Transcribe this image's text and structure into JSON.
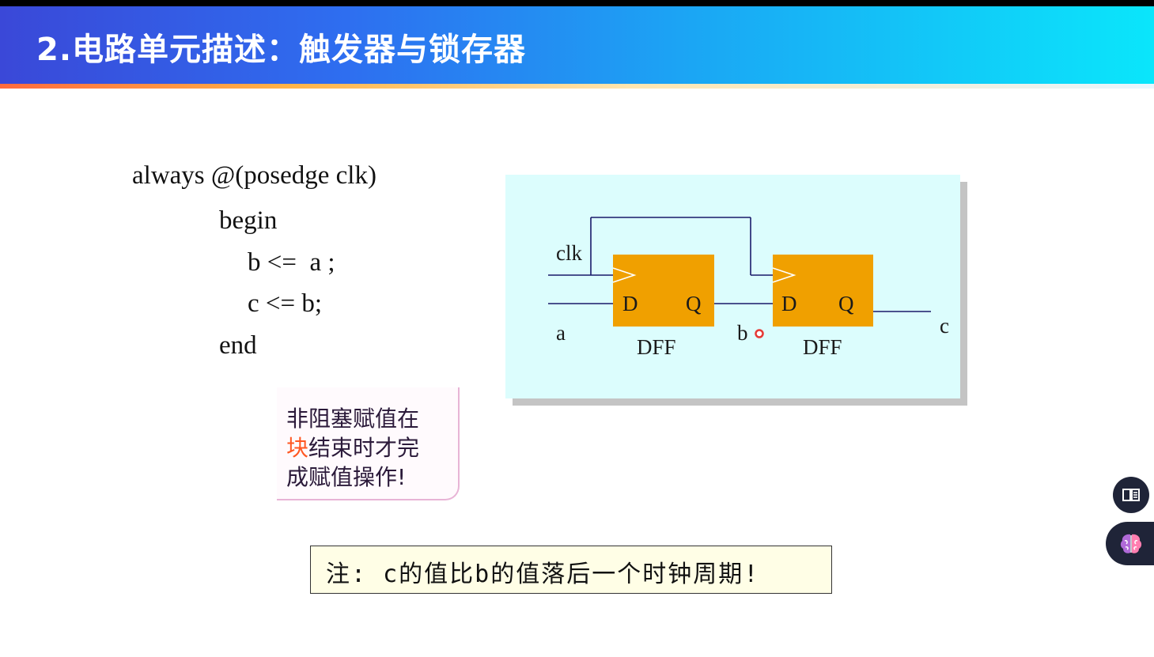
{
  "header": {
    "title": "2.电路单元描述：触发器与锁存器"
  },
  "code": {
    "line1": "always @(posedge clk)",
    "line2": "begin",
    "line3": "b <=  a ;",
    "line4": "c <= b;",
    "line5": "end"
  },
  "diagram": {
    "clk_label": "clk",
    "a_label": "a",
    "b_label": "b",
    "c_label": "c",
    "dff1": {
      "d": "D",
      "q": "Q",
      "name": "DFF"
    },
    "dff2": {
      "d": "D",
      "q": "Q",
      "name": "DFF"
    },
    "colors": {
      "background": "#dcfdfd",
      "flipflop": "#f0a000",
      "wire": "#1a1a6a"
    }
  },
  "callout": {
    "line1": "非阻塞赋值在",
    "line2_highlight": "块",
    "line2_rest": "结束时才完",
    "line3": "成赋值操作!"
  },
  "note": {
    "text": "注: c的值比b的值落后一个时钟周期!"
  },
  "side_buttons": {
    "book_icon": "book-reader-icon",
    "brain_icon": "brain-icon"
  }
}
